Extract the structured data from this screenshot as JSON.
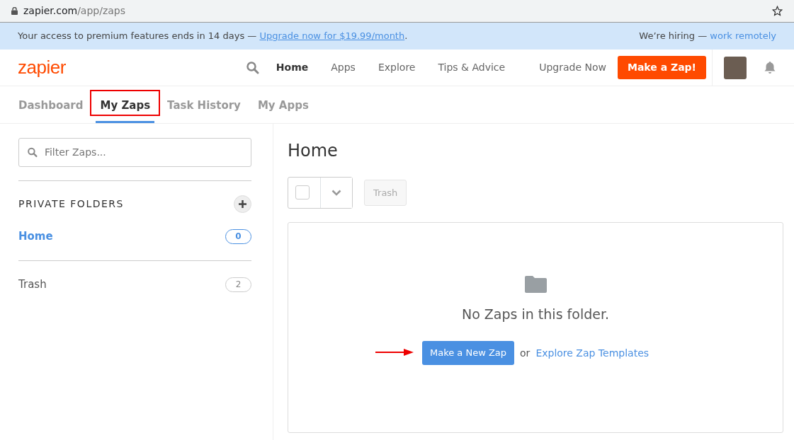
{
  "browser": {
    "domain": "zapier.com",
    "path": "/app/zaps"
  },
  "banner": {
    "message": "Your access to premium features ends in 14 days —",
    "link": "Upgrade now for $19.99/month",
    "suffix": ".",
    "hiring": "We’re hiring —",
    "hiring_link": "work remotely"
  },
  "header": {
    "logo": "zapier",
    "nav": [
      {
        "label": "Home",
        "selected": true
      },
      {
        "label": "Apps",
        "selected": false
      },
      {
        "label": "Explore",
        "selected": false
      },
      {
        "label": "Tips & Advice",
        "selected": false
      }
    ],
    "upgrade": "Upgrade Now",
    "cta": "Make a Zap!"
  },
  "tabs": [
    {
      "label": "Dashboard",
      "selected": false,
      "highlighted": false
    },
    {
      "label": "My Zaps",
      "selected": true,
      "highlighted": true
    },
    {
      "label": "Task History",
      "selected": false,
      "highlighted": false
    },
    {
      "label": "My Apps",
      "selected": false,
      "highlighted": false
    }
  ],
  "sidebar": {
    "search": {
      "placeholder": "Filter Zaps..."
    },
    "section_title": "PRIVATE FOLDERS",
    "folders": [
      {
        "name": "Home",
        "count": "0",
        "selected": true
      },
      {
        "name": "Trash",
        "count": "2",
        "selected": false
      }
    ]
  },
  "main": {
    "title": "Home",
    "select_all": {
      "checked": false
    },
    "trash_button": {
      "label": "Trash",
      "disabled": true
    },
    "empty": {
      "message": "No Zaps in this folder.",
      "button": "Make a New Zap",
      "or": "or",
      "link": "Explore Zap Templates",
      "arrow": true
    }
  }
}
